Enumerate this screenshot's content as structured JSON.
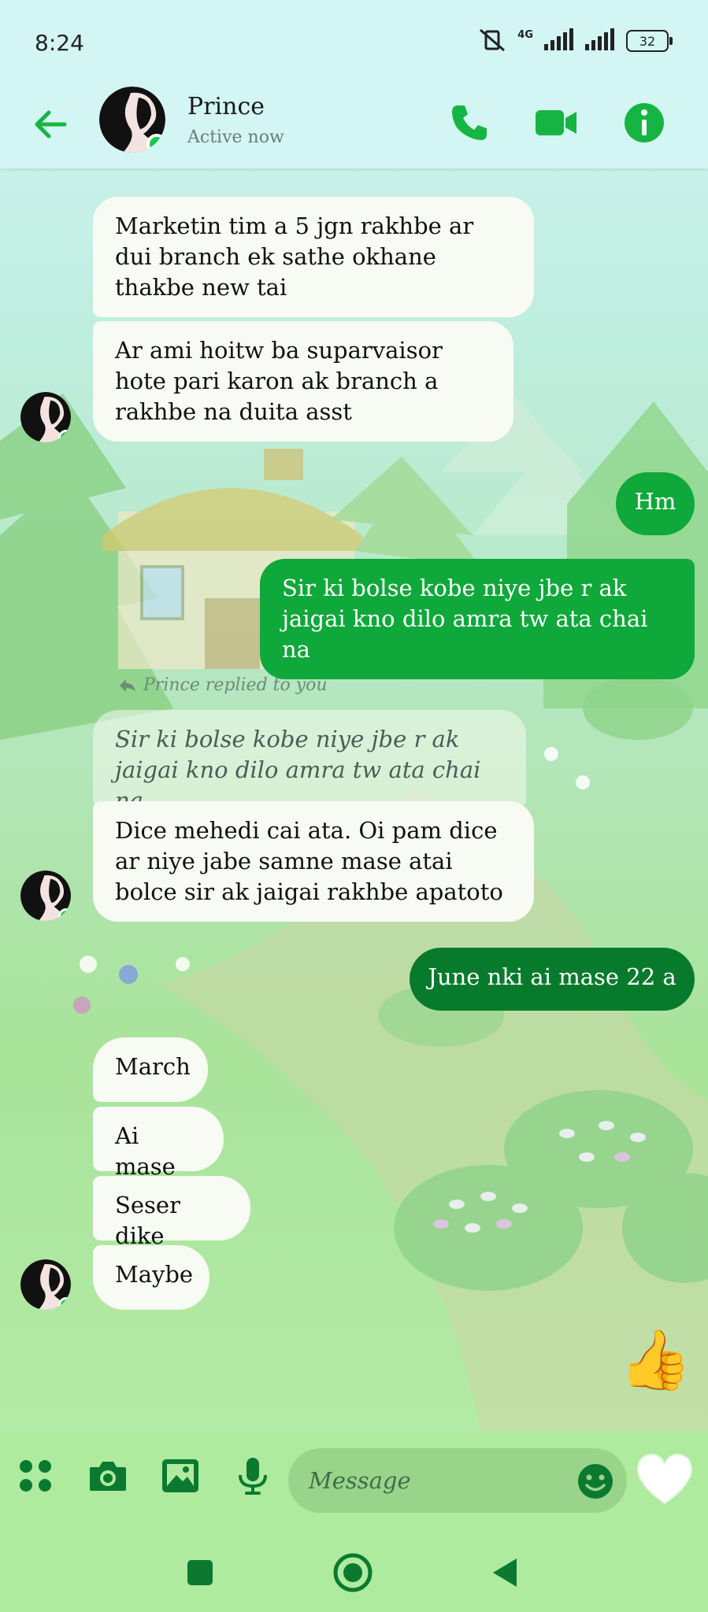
{
  "status_bar": {
    "time": "8:24",
    "network": "4G",
    "battery": "32"
  },
  "header": {
    "contact_name": "Prince",
    "contact_status": "Active now",
    "icons": [
      "back-arrow-icon",
      "phone-icon",
      "video-camera-icon",
      "info-icon"
    ]
  },
  "messages": {
    "m1": "Marketin tim a 5 jgn rakhbe ar dui branch ek sathe okhane thakbe new tai",
    "m2": "Ar ami hoitw ba suparvaisor hote pari karon ak branch a rakhbe na duita asst",
    "m3": "Hm",
    "m4": "Sir ki bolse kobe niye jbe r ak jaigai kno dilo amra tw ata chai na",
    "reply_label": "Prince replied to you",
    "reply_quote": "Sir ki bolse kobe niye jbe r ak jaigai kno dilo amra tw ata chai na",
    "m5": "Dice mehedi cai ata. Oi pam dice ar niye jabe samne mase atai bolce sir ak jaigai rakhbe apatoto",
    "m6": "June nki ai mase 22 a",
    "m7": "March",
    "m8": "Ai mase",
    "m9": "Seser dike",
    "m10": "Maybe",
    "thumb": "👍"
  },
  "composer": {
    "placeholder": "Message"
  },
  "colors": {
    "accent": "#16b543",
    "my_bubble": "#0fa83a",
    "their_bubble": "#f7fbf3"
  }
}
